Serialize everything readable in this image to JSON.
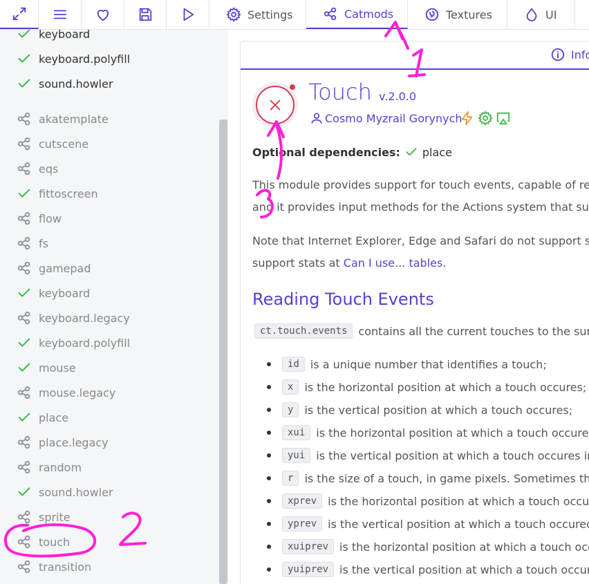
{
  "toolbar": {
    "buttons": [
      {
        "name": "fullscreen",
        "icon": "maximize-icon"
      },
      {
        "name": "menu",
        "icon": "menu-icon"
      },
      {
        "name": "favorite",
        "icon": "heart-icon"
      },
      {
        "name": "save",
        "icon": "save-icon"
      },
      {
        "name": "launch",
        "icon": "play-icon"
      }
    ],
    "tabs": [
      {
        "label": "Settings",
        "icon": "gear-icon",
        "active": false
      },
      {
        "label": "Catmods",
        "icon": "share-nodes-icon",
        "active": true
      },
      {
        "label": "Textures",
        "icon": "texture-icon",
        "active": false
      },
      {
        "label": "UI",
        "icon": "droplet-icon",
        "active": false
      }
    ],
    "accent_color": "#5144cf"
  },
  "sidebar": {
    "enabled_top": [
      "keyboard",
      "keyboard.polyfill",
      "sound.howler"
    ],
    "modules": [
      {
        "name": "akatemplate",
        "enabled": false
      },
      {
        "name": "cutscene",
        "enabled": false
      },
      {
        "name": "eqs",
        "enabled": false
      },
      {
        "name": "fittoscreen",
        "enabled": true
      },
      {
        "name": "flow",
        "enabled": false
      },
      {
        "name": "fs",
        "enabled": false
      },
      {
        "name": "gamepad",
        "enabled": false
      },
      {
        "name": "keyboard",
        "enabled": true
      },
      {
        "name": "keyboard.legacy",
        "enabled": false
      },
      {
        "name": "keyboard.polyfill",
        "enabled": true
      },
      {
        "name": "mouse",
        "enabled": true
      },
      {
        "name": "mouse.legacy",
        "enabled": false
      },
      {
        "name": "place",
        "enabled": true
      },
      {
        "name": "place.legacy",
        "enabled": false
      },
      {
        "name": "random",
        "enabled": false
      },
      {
        "name": "sound.howler",
        "enabled": true
      },
      {
        "name": "sprite",
        "enabled": false
      },
      {
        "name": "touch",
        "enabled": false
      },
      {
        "name": "transition",
        "enabled": false
      }
    ]
  },
  "module": {
    "info_tab": "Info",
    "title": "Touch",
    "version": "v.2.0.0",
    "author": "Cosmo Myzrail Gorynych",
    "optional_deps_label": "Optional dependencies:",
    "optional_deps": [
      "place"
    ],
    "intro": "This module provides support for touch events, capable of registe",
    "intro2": "and it provides input methods for the Actions system that support",
    "note": "Note that Internet Explorer, Edge and Safari do not support such e",
    "note2_prefix": "support stats at ",
    "note2_link": "Can I use... tables",
    "note2_suffix": ".",
    "heading": "Reading Touch Events",
    "events_code": "ct.touch.events",
    "events_text": "contains all the current touches to the surface",
    "fields": [
      {
        "code": "id",
        "text": "is a unique number that identifies a touch;"
      },
      {
        "code": "x",
        "text": "is the horizontal position at which a touch occures;"
      },
      {
        "code": "y",
        "text": "is the vertical position at which a touch occures;"
      },
      {
        "code": "xui",
        "text": "is the horizontal position at which a touch occures in"
      },
      {
        "code": "yui",
        "text": "is the vertical position at which a touch occures in UI"
      },
      {
        "code": "r",
        "text": "is the size of a touch, in game pixels. Sometimes this va"
      },
      {
        "code": "xprev",
        "text": "is the horizontal position at which a touch occured"
      },
      {
        "code": "yprev",
        "text": "is the vertical position at which a touch occured in t"
      },
      {
        "code": "xuiprev",
        "text": "is the horizontal position at which a touch occure"
      },
      {
        "code": "yuiprev",
        "text": "is the vertical position at which a touch occured i"
      }
    ]
  },
  "annotations": {
    "labels": [
      "1",
      "2",
      "3"
    ],
    "color": "#ff1fd6"
  }
}
